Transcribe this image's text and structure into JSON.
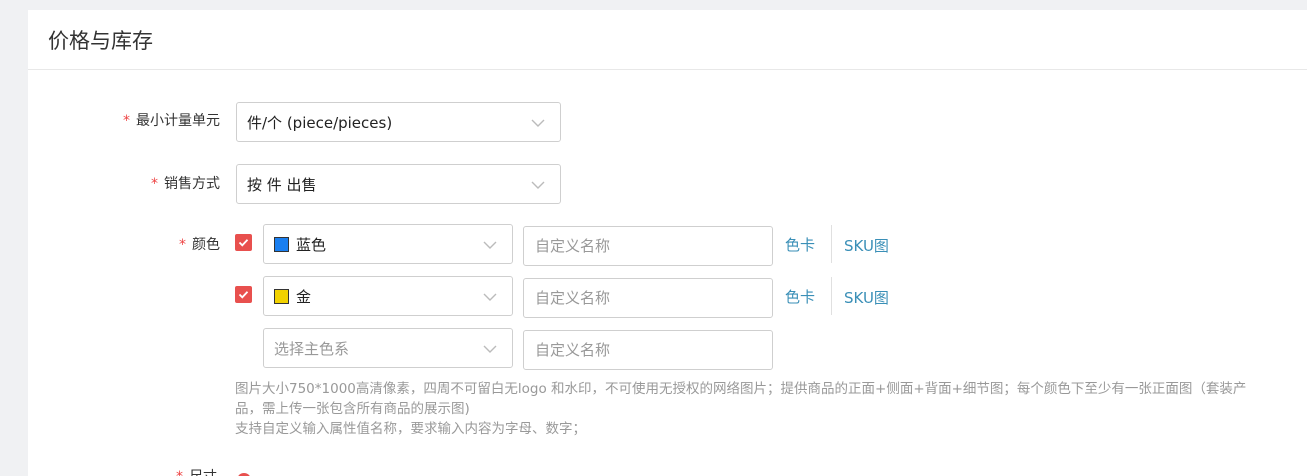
{
  "panel": {
    "title": "价格与库存"
  },
  "unit": {
    "required_mark": "*",
    "label": "最小计量单元",
    "value": "件/个 (piece/pieces)"
  },
  "sale": {
    "required_mark": "*",
    "label": "销售方式",
    "value": "按 件 出售"
  },
  "color": {
    "required_mark": "*",
    "label": "颜色",
    "rows": [
      {
        "checked": true,
        "swatch": "#1a7ff0",
        "value": "蓝色",
        "custom_placeholder": "自定义名称",
        "card_link": "色卡",
        "sku_link": "SKU图"
      },
      {
        "checked": true,
        "swatch": "#f2d200",
        "value": "金",
        "custom_placeholder": "自定义名称",
        "card_link": "色卡",
        "sku_link": "SKU图"
      },
      {
        "checked": false,
        "value_placeholder": "选择主色系",
        "custom_placeholder": "自定义名称"
      }
    ]
  },
  "hint": {
    "line1": "图片大小750*1000高清像素，四周不可留白无logo 和水印，不可使用无授权的网络图片；提供商品的正面+侧面+背面+细节图；每个颜色下至少有一张正面图（套装产品，需上传一张包含所有商品的展示图)",
    "line2": "支持自定义输入属性值名称，要求输入内容为字母、数字；"
  },
  "next_field": {
    "required_mark": "*",
    "label": "尺寸"
  },
  "colors": {
    "accent": "#3a8fb7",
    "required": "#e8504e"
  }
}
